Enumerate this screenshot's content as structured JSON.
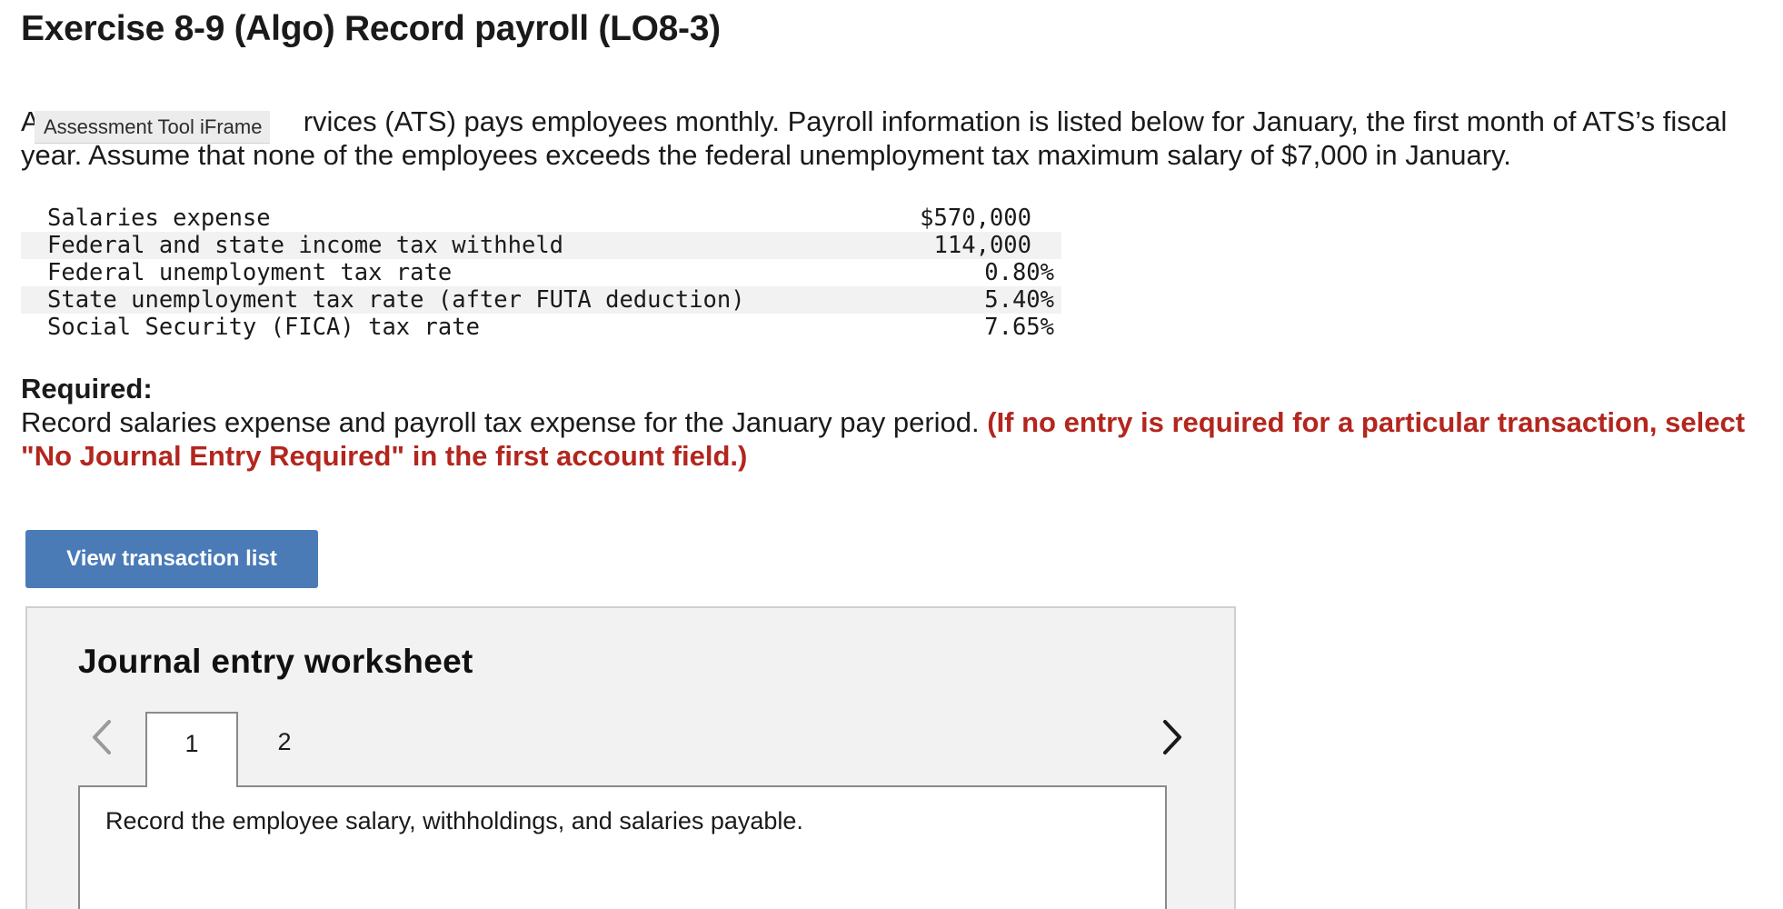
{
  "exercise": {
    "title": "Exercise 8-9 (Algo) Record payroll (LO8-3)"
  },
  "intro": {
    "lead": "A",
    "text_after_tooltip": "rvices (ATS) pays employees monthly. Payroll information is listed below for January, the first month of ATS’s fiscal year. Assume that none of the employees exceeds the federal unemployment tax maximum salary of $7,000 in January."
  },
  "tooltip": {
    "label": "Assessment Tool iFrame"
  },
  "payroll_table": {
    "rows": [
      {
        "label": "Salaries expense",
        "value": "$570,000"
      },
      {
        "label": "Federal and state income tax withheld",
        "value": "114,000"
      },
      {
        "label": "Federal unemployment tax rate",
        "value": "0.80%"
      },
      {
        "label": "State unemployment tax rate (after FUTA deduction)",
        "value": "5.40%"
      },
      {
        "label": "Social Security (FICA) tax rate",
        "value": "7.65%"
      }
    ]
  },
  "required": {
    "label": "Required:",
    "text": "Record salaries expense and payroll tax expense for the January pay period.",
    "note": "(If no entry is required for a particular transaction, select \"No Journal Entry Required\" in the first account field.)"
  },
  "buttons": {
    "view_transaction_list": "View transaction list"
  },
  "worksheet": {
    "title": "Journal entry worksheet",
    "tabs": [
      "1",
      "2"
    ],
    "active_tab": "1",
    "instruction": "Record the employee salary, withholdings, and salaries payable.",
    "icons": {
      "prev": "chevron-left-icon",
      "next": "chevron-right-icon"
    },
    "colors": {
      "button": "#4a7bb7",
      "note_red": "#b3261e",
      "panel_bg": "#f2f2f2"
    }
  }
}
